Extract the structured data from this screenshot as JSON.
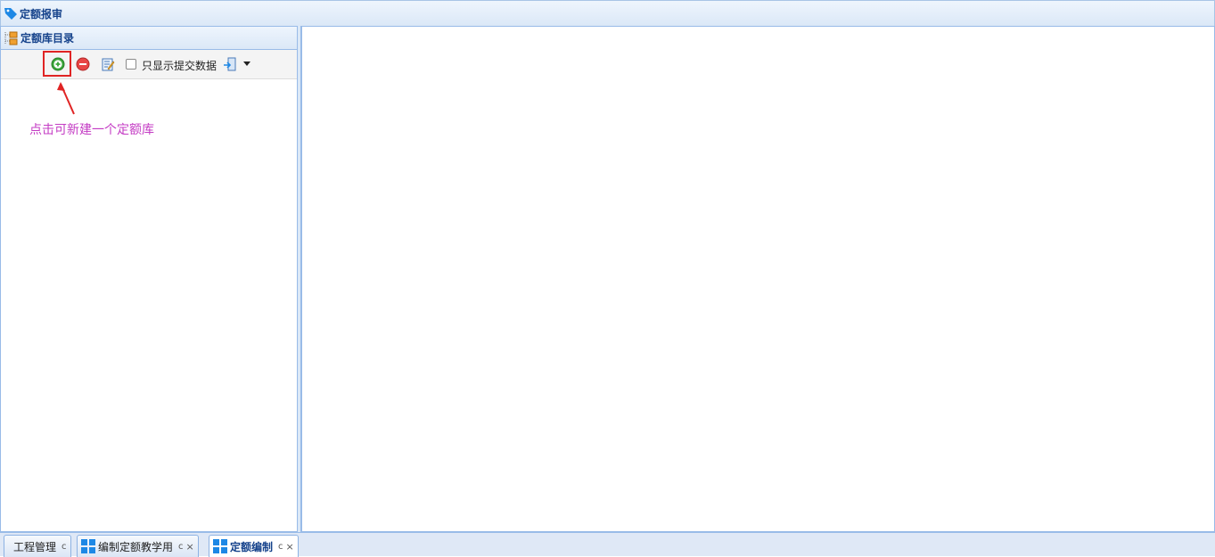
{
  "window": {
    "title": "定额报审"
  },
  "left_panel": {
    "header": "定额库目录",
    "toolbar": {
      "add_icon": "add-circle-icon",
      "delete_icon": "remove-circle-icon",
      "edit_icon": "edit-icon",
      "checkbox_label": "只显示提交数据",
      "checkbox_checked": false,
      "export_icon": "export-icon",
      "menu_icon": "caret-down-icon"
    }
  },
  "annotation": {
    "text": "点击可新建一个定额库",
    "color": "#c43cc4"
  },
  "tabs": [
    {
      "label": "工程管理",
      "refresh": "c",
      "close": "",
      "active": false
    },
    {
      "label": "编制定额教学用",
      "refresh": "c",
      "close": "×",
      "active": false
    },
    {
      "label": "定额编制",
      "refresh": "c",
      "close": "×",
      "active": true
    }
  ],
  "colors": {
    "header_text": "#15428b",
    "border": "#99bbe8",
    "highlight": "#e02424"
  }
}
